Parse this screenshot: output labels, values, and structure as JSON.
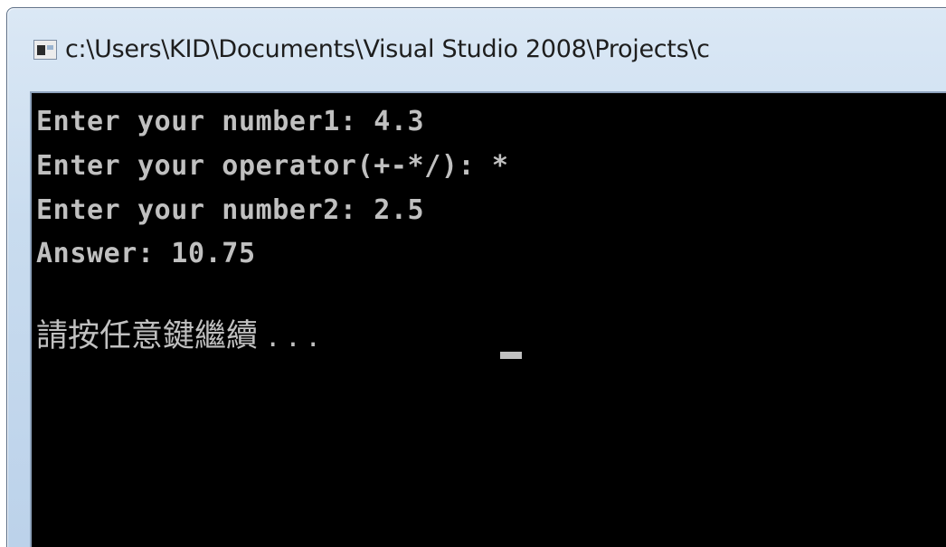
{
  "window": {
    "title": "c:\\Users\\KID\\Documents\\Visual Studio 2008\\Projects\\c",
    "icon": "console-window-icon"
  },
  "console": {
    "lines": [
      "Enter your number1: 4.3",
      "Enter your operator(+-*/): *",
      "Enter your number2: 2.5",
      "Answer: 10.75"
    ],
    "prompt": "請按任意鍵繼續 . . . "
  },
  "colors": {
    "console_background": "#000000",
    "console_text": "#c0c0c0",
    "titlebar": "#c9dcef"
  }
}
